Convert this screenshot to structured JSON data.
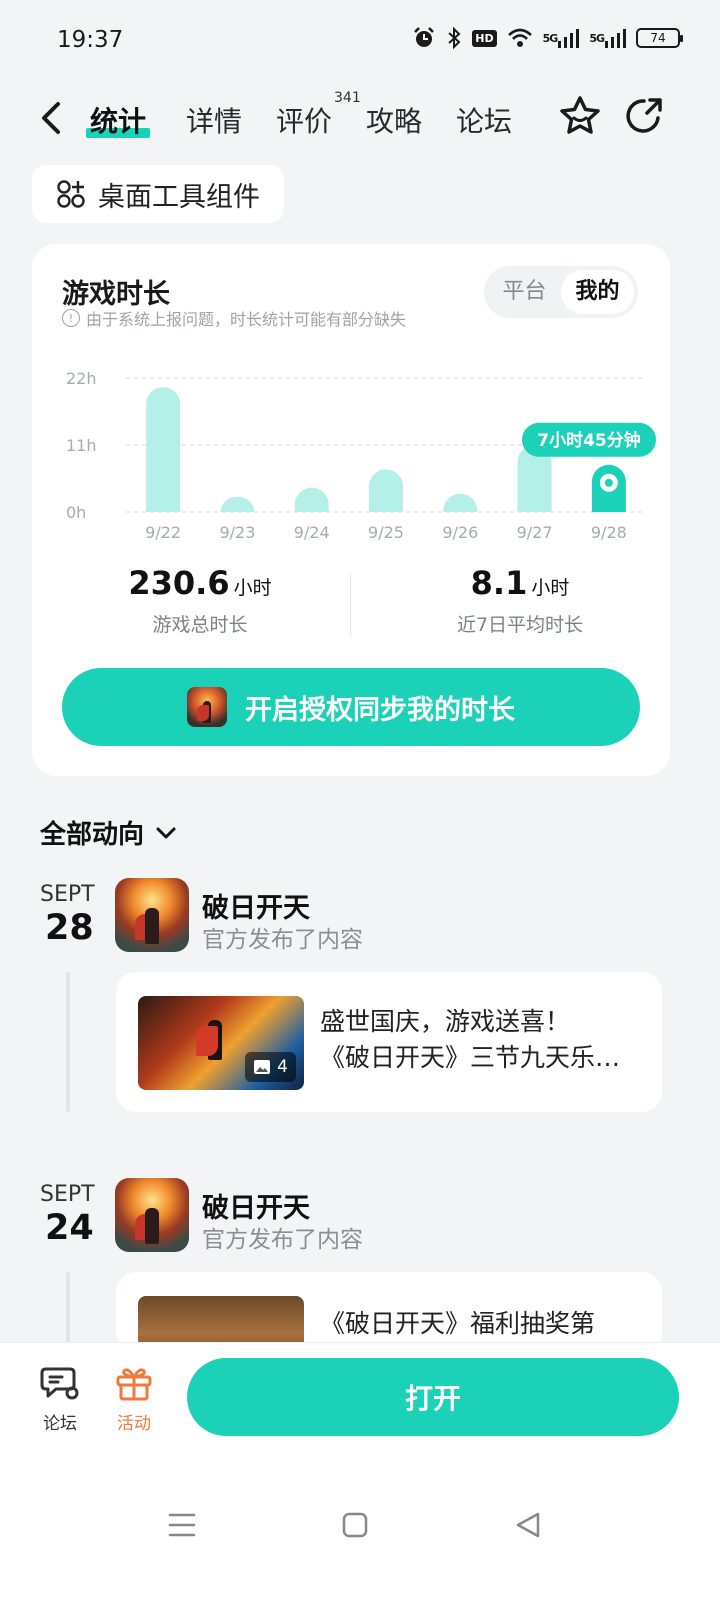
{
  "status_bar": {
    "time": "19:37",
    "hd_label": "HD",
    "signal1": "5G",
    "signal2": "5G",
    "battery": "74"
  },
  "nav": {
    "tabs": [
      {
        "label": "统计",
        "active": true
      },
      {
        "label": "详情",
        "active": false
      },
      {
        "label": "评价",
        "active": false
      },
      {
        "label": "攻略",
        "active": false
      },
      {
        "label": "论坛",
        "active": false
      }
    ],
    "review_count": "341"
  },
  "widget_chip": {
    "label": "桌面工具组件"
  },
  "playtime_card": {
    "title": "游戏时长",
    "note": "由于系统上报问题，时长统计可能有部分缺失",
    "segment": {
      "options": [
        "平台",
        "我的"
      ],
      "selected": "我的"
    },
    "stats": {
      "total_value": "230.6",
      "total_unit": "小时",
      "total_label": "游戏总时长",
      "avg_value": "8.1",
      "avg_unit": "小时",
      "avg_label": "近7日平均时长"
    },
    "sync_button_label": "开启授权同步我的时长"
  },
  "chart_data": {
    "type": "bar",
    "categories": [
      "9/22",
      "9/23",
      "9/24",
      "9/25",
      "9/26",
      "9/27",
      "9/28"
    ],
    "values": [
      20.5,
      2.5,
      4,
      7,
      3,
      11,
      7.75
    ],
    "y_ticks": [
      "0h",
      "11h",
      "22h"
    ],
    "ylim": [
      0,
      22
    ],
    "highlight": {
      "index": 6,
      "label": "7小时45分钟"
    },
    "grid": true,
    "colors": {
      "bar": "#b4f0e8",
      "highlight": "#1bd1b7"
    }
  },
  "feed": {
    "header": "全部动向",
    "items": [
      {
        "month": "SEPT",
        "day": "28",
        "poster": "破日开天",
        "action": "官方发布了内容",
        "post_line1": "盛世国庆，游戏送喜！",
        "post_line2": "《破日开天》三节九天乐…",
        "image_count": "4"
      },
      {
        "month": "SEPT",
        "day": "24",
        "poster": "破日开天",
        "action": "官方发布了内容",
        "post_line1": "《破日开天》福利抽奖第"
      }
    ]
  },
  "bottom_bar": {
    "forum_label": "论坛",
    "activity_label": "活动",
    "open_label": "打开"
  },
  "colors": {
    "accent": "#1bd1b7",
    "activity": "#f07a3a"
  }
}
